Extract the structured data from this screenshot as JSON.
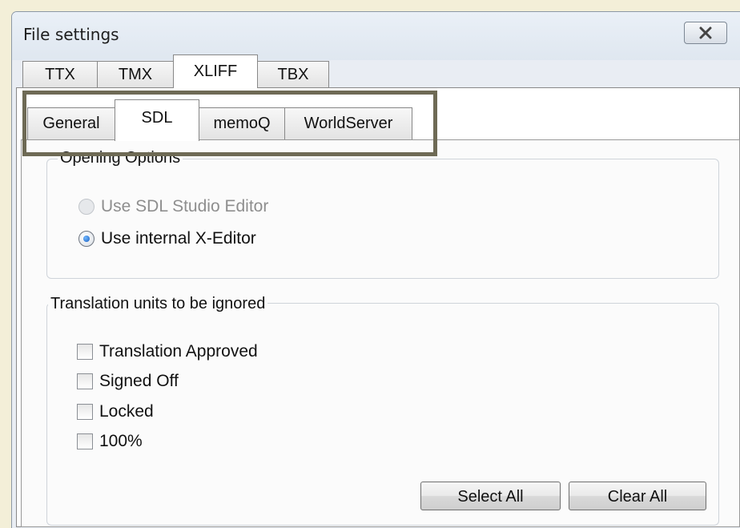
{
  "window": {
    "title": "File settings"
  },
  "top_tabs": [
    {
      "label": "TTX"
    },
    {
      "label": "TMX"
    },
    {
      "label": "XLIFF"
    },
    {
      "label": "TBX"
    }
  ],
  "sub_tabs": [
    {
      "label": "General"
    },
    {
      "label": "SDL"
    },
    {
      "label": "memoQ"
    },
    {
      "label": "WorldServer"
    }
  ],
  "selected_top_tab": "XLIFF",
  "selected_sub_tab": "SDL",
  "opening_options": {
    "legend": "Opening Options",
    "options": [
      {
        "label": "Use SDL Studio Editor",
        "enabled": false,
        "selected": false
      },
      {
        "label": "Use internal X-Editor",
        "enabled": true,
        "selected": true
      }
    ]
  },
  "ignored_units": {
    "legend": "Translation units to be ignored",
    "items": [
      {
        "label": "Translation Approved",
        "checked": false
      },
      {
        "label": "Signed Off",
        "checked": false
      },
      {
        "label": "Locked",
        "checked": false
      },
      {
        "label": "100%",
        "checked": false
      }
    ],
    "select_all_label": "Select All",
    "clear_all_label": "Clear All"
  }
}
